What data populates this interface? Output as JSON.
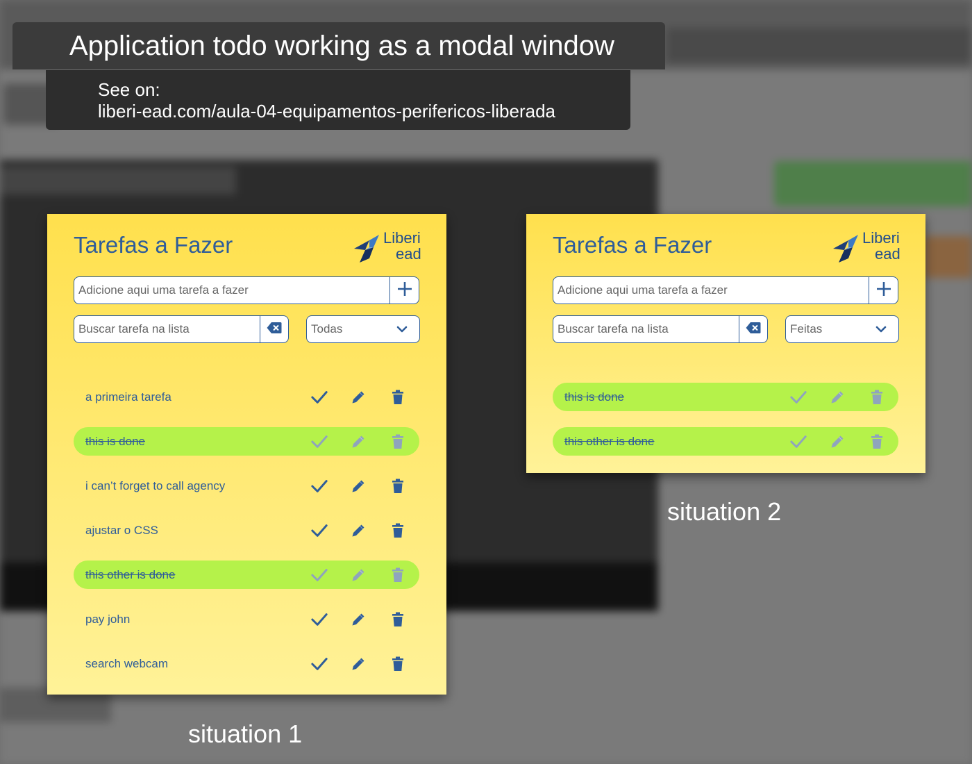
{
  "banner": {
    "title": "Application todo working as a modal window",
    "see_on": "See on:",
    "url": "liberi-ead.com/aula-04-equipamentos-perifericos-liberada"
  },
  "colors": {
    "primary_blue": "#2f5d99",
    "done_green": "#b5f24a",
    "modal_yellow_top": "#ffe04d",
    "modal_yellow_bottom": "#fff298"
  },
  "icons": {
    "add": "plus-icon",
    "clear": "backspace-icon",
    "dropdown": "chevron-down-icon",
    "complete": "check-icon",
    "edit": "pencil-icon",
    "delete": "trash-icon",
    "logo": "liberi-bird-logo"
  },
  "situation1": {
    "title": "Tarefas a Fazer",
    "logo": {
      "line1": "Liberi",
      "line2": "ead"
    },
    "add_placeholder": "Adicione aqui uma tarefa a fazer",
    "search_placeholder": "Buscar tarefa na lista",
    "filter": "Todas",
    "tasks": [
      {
        "text": "a primeira tarefa",
        "done": false
      },
      {
        "text": "this is done",
        "done": true
      },
      {
        "text": "i can’t forget to call agency",
        "done": false
      },
      {
        "text": "ajustar o CSS",
        "done": false
      },
      {
        "text": "this other is done",
        "done": true
      },
      {
        "text": "pay john",
        "done": false
      },
      {
        "text": "search webcam",
        "done": false
      }
    ],
    "caption": "situation 1"
  },
  "situation2": {
    "title": "Tarefas a Fazer",
    "logo": {
      "line1": "Liberi",
      "line2": "ead"
    },
    "add_placeholder": "Adicione aqui uma tarefa a fazer",
    "search_placeholder": "Buscar tarefa na lista",
    "filter": "Feitas",
    "tasks": [
      {
        "text": "this is done",
        "done": true
      },
      {
        "text": "this other is done",
        "done": true
      }
    ],
    "caption": "situation 2"
  }
}
